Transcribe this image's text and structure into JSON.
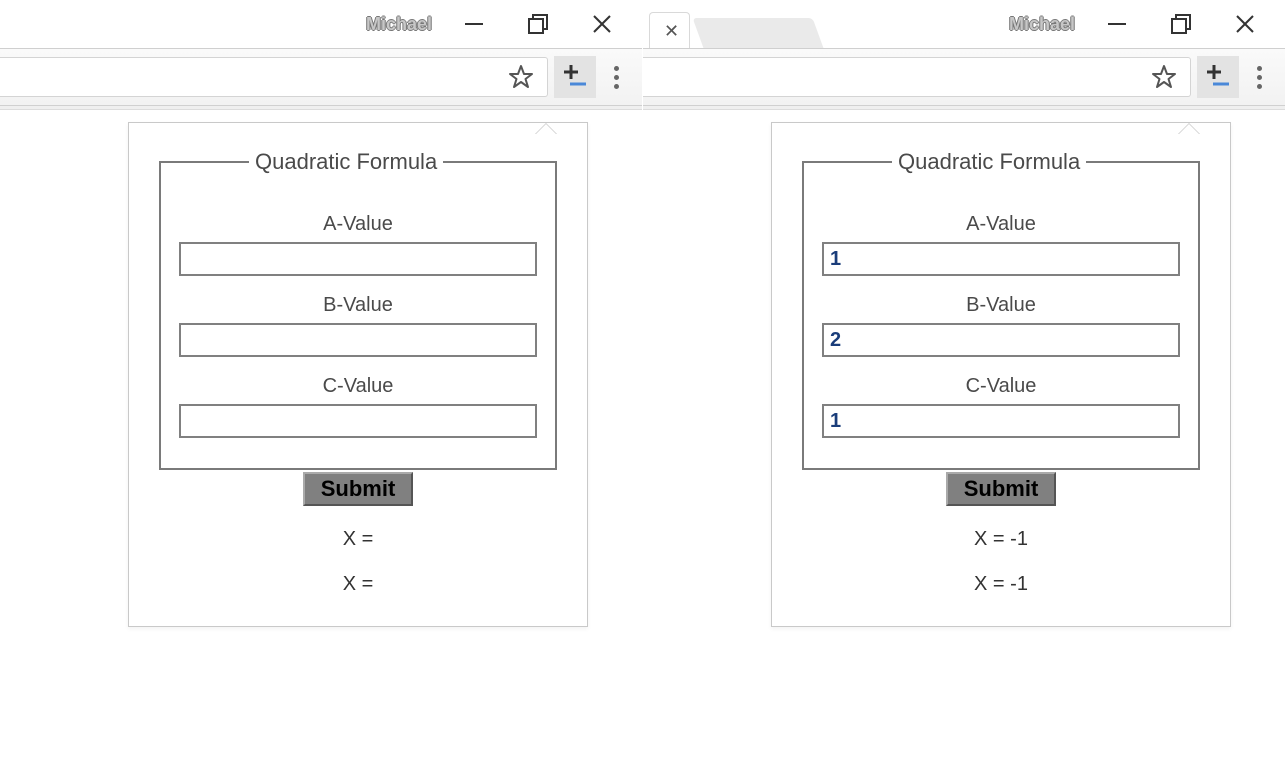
{
  "windows": [
    {
      "profile": "Michael",
      "showTabBar": false,
      "extensionActive": true,
      "popup": {
        "legend": "Quadratic Formula",
        "fields": {
          "a": {
            "label": "A-Value",
            "value": ""
          },
          "b": {
            "label": "B-Value",
            "value": ""
          },
          "c": {
            "label": "C-Value",
            "value": ""
          }
        },
        "submitLabel": "Submit",
        "results": {
          "x1": "X =",
          "x2": "X ="
        }
      }
    },
    {
      "profile": "Michael",
      "showTabBar": true,
      "extensionActive": true,
      "popup": {
        "legend": "Quadratic Formula",
        "fields": {
          "a": {
            "label": "A-Value",
            "value": "1"
          },
          "b": {
            "label": "B-Value",
            "value": "2"
          },
          "c": {
            "label": "C-Value",
            "value": "1"
          }
        },
        "submitLabel": "Submit",
        "results": {
          "x1": "X = -1",
          "x2": "X = -1"
        }
      }
    }
  ]
}
